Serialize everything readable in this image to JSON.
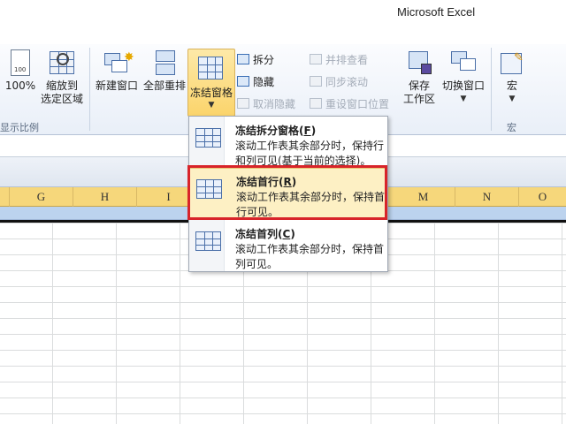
{
  "window": {
    "title": "Microsoft Excel"
  },
  "ribbon": {
    "zoom100_label": "100%",
    "zoom_to_selection_label": "缩放到\n选定区域",
    "group_zoom_label": "显示比例",
    "new_window_label": "新建窗口",
    "arrange_all_label": "全部重排",
    "freeze_panes_label": "冻结窗格",
    "split_label": "拆分",
    "hide_label": "隐藏",
    "unhide_label": "取消隐藏",
    "view_side_by_side_label": "并排查看",
    "sync_scroll_label": "同步滚动",
    "reset_window_pos_label": "重设窗口位置",
    "save_workspace_label": "保存\n工作区",
    "switch_windows_label": "切换窗口",
    "macros_label": "宏",
    "group_macros_label": "宏"
  },
  "columns": [
    "G",
    "H",
    "I",
    "M",
    "N",
    "O"
  ],
  "menu": {
    "items": [
      {
        "title": "冻结拆分窗格",
        "key": "F",
        "desc": "滚动工作表其余部分时，保持行和列可见(基于当前的选择)。"
      },
      {
        "title": "冻结首行",
        "key": "R",
        "desc": "滚动工作表其余部分时，保持首行可见。"
      },
      {
        "title": "冻结首列",
        "key": "C",
        "desc": "滚动工作表其余部分时，保持首列可见。"
      }
    ]
  },
  "colors": {
    "highlight_border": "#d8242a",
    "header_fill": "#f6d77b",
    "row_selected": "#bcd3ee"
  }
}
